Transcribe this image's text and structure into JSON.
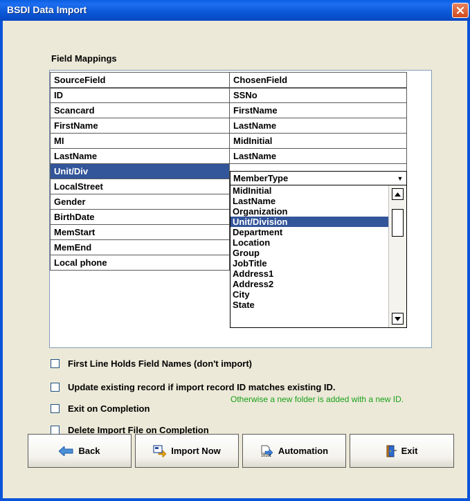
{
  "window": {
    "title": "BSDI Data Import",
    "close_icon": "close-icon"
  },
  "field_mappings": {
    "label": "Field Mappings",
    "columns": [
      "SourceField",
      "ChosenField"
    ],
    "rows": [
      {
        "source": "ID",
        "chosen": "SSNo"
      },
      {
        "source": "Scancard",
        "chosen": "FirstName"
      },
      {
        "source": "FirstName",
        "chosen": "LastName"
      },
      {
        "source": "MI",
        "chosen": "MidInitial"
      },
      {
        "source": "LastName",
        "chosen": "LastName"
      },
      {
        "source": "Unit/Div",
        "chosen": "MemberType"
      },
      {
        "source": "LocalStreet",
        "chosen": ""
      },
      {
        "source": "Gender",
        "chosen": ""
      },
      {
        "source": "BirthDate",
        "chosen": ""
      },
      {
        "source": "MemStart",
        "chosen": ""
      },
      {
        "source": "MemEnd",
        "chosen": ""
      },
      {
        "source": "Local phone",
        "chosen": ""
      }
    ],
    "selected_source": "Unit/Div",
    "combo_value": "MemberType",
    "dropdown_options": [
      "MidInitial",
      "LastName",
      "Organization",
      "Unit/Division",
      "Department",
      "Location",
      "Group",
      "JobTitle",
      "Address1",
      "Address2",
      "City",
      "State"
    ],
    "dropdown_selected": "Unit/Division"
  },
  "options": {
    "first_line": {
      "label": "First Line Holds Field Names (don't import)",
      "checked": false
    },
    "update_existing": {
      "label": "Update existing record if import record ID matches existing ID.",
      "checked": false
    },
    "update_note": "Otherwise a new folder is added with a new ID.",
    "exit_on_completion": {
      "label": "Exit on Completion",
      "checked": false
    },
    "delete_file": {
      "label": "Delete Import File on Completion",
      "checked": false
    }
  },
  "buttons": {
    "back": {
      "label": "Back",
      "icon": "arrow-left-icon"
    },
    "import_now": {
      "label": "Import Now",
      "icon": "import-icon"
    },
    "automation": {
      "label": "Automation",
      "icon": "automation-icon"
    },
    "exit": {
      "label": "Exit",
      "icon": "door-exit-icon"
    }
  },
  "colors": {
    "title_bar": "#0a58d6",
    "selection": "#33559a",
    "note": "#19a019",
    "dialog_bg": "#ece9d8"
  }
}
